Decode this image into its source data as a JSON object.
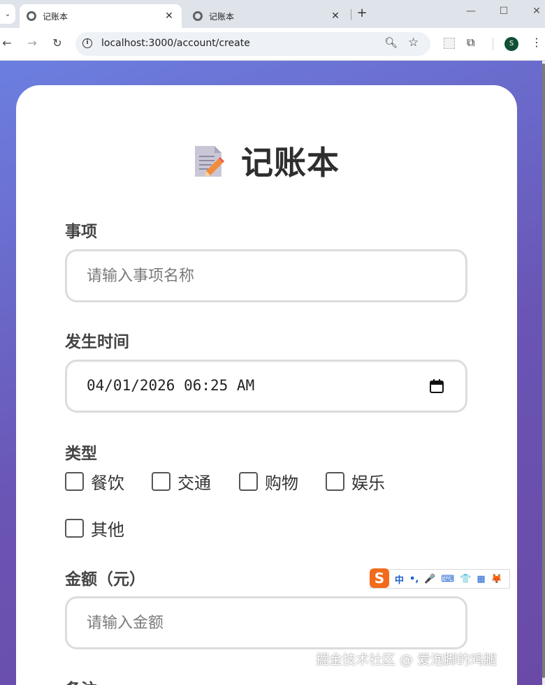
{
  "browser": {
    "tabs": [
      {
        "title": "记账本",
        "close": "✕"
      },
      {
        "title": "记账本",
        "close": "✕"
      }
    ],
    "new_tab": "+",
    "window_controls": {
      "minimize": "—",
      "maximize": "☐",
      "close": "✕"
    },
    "nav": {
      "back": "←",
      "forward": "→",
      "reload": "↻"
    },
    "url": "localhost:3000/account/create",
    "profile_initial": "S",
    "icons": [
      "tab-list-icon",
      "globe-icon",
      "info-icon",
      "zoom-icon",
      "star-icon",
      "extension-icon",
      "puzzle-icon",
      "kebab-menu-icon"
    ]
  },
  "page": {
    "title": "记账本",
    "fields": {
      "item": {
        "label": "事项",
        "placeholder": "请输入事项名称"
      },
      "time": {
        "label": "发生时间",
        "value": "04/01/2026 06:25 AM"
      },
      "type": {
        "label": "类型",
        "options": [
          "餐饮",
          "交通",
          "购物",
          "娱乐",
          "其他"
        ]
      },
      "amount": {
        "label": "金额（元）",
        "placeholder": "请输入金额"
      },
      "remark": {
        "label": "备注"
      }
    }
  },
  "ime": {
    "logo": "S",
    "items": [
      "中",
      "•,",
      "🎤",
      "⌨",
      "👕",
      "▦",
      "🦊"
    ]
  },
  "watermark": "掘金技术社区 @ 爱泡脚的鸡腿",
  "colors": {
    "gradient_start": "#6b7fe0",
    "gradient_end": "#6a4aa6",
    "card": "#ffffff",
    "input_border": "#dcdcdc",
    "label_text": "#444444",
    "ime_orange": "#f26a1b",
    "profile_green": "#0f5132"
  }
}
